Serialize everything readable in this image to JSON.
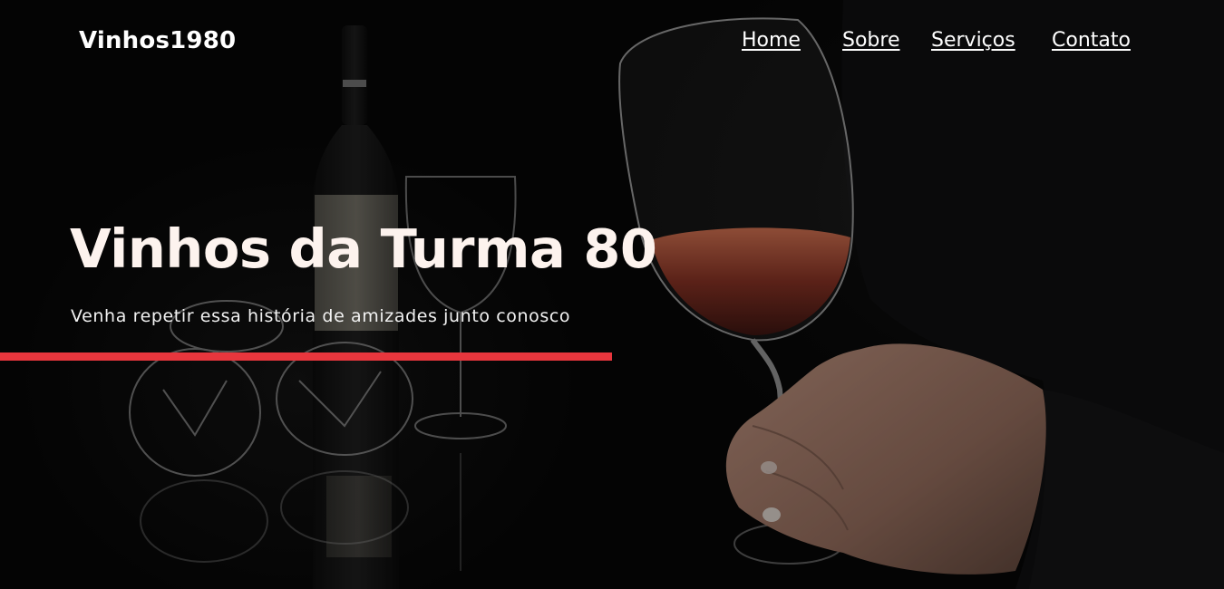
{
  "header": {
    "brand": "Vinhos1980",
    "nav": [
      {
        "label": "Home"
      },
      {
        "label": "Sobre"
      },
      {
        "label": "Serviços"
      },
      {
        "label": "Contato"
      }
    ]
  },
  "hero": {
    "title": "Vinhos da Turma 80",
    "subtitle": "Venha repetir essa história de amizades junto conosco",
    "background_image": "wine-glass-hand-bottle-photo"
  },
  "colors": {
    "accent": "#e8363d",
    "background": "#050505",
    "text": "#ffffff",
    "wine": "#8a3a2a"
  }
}
